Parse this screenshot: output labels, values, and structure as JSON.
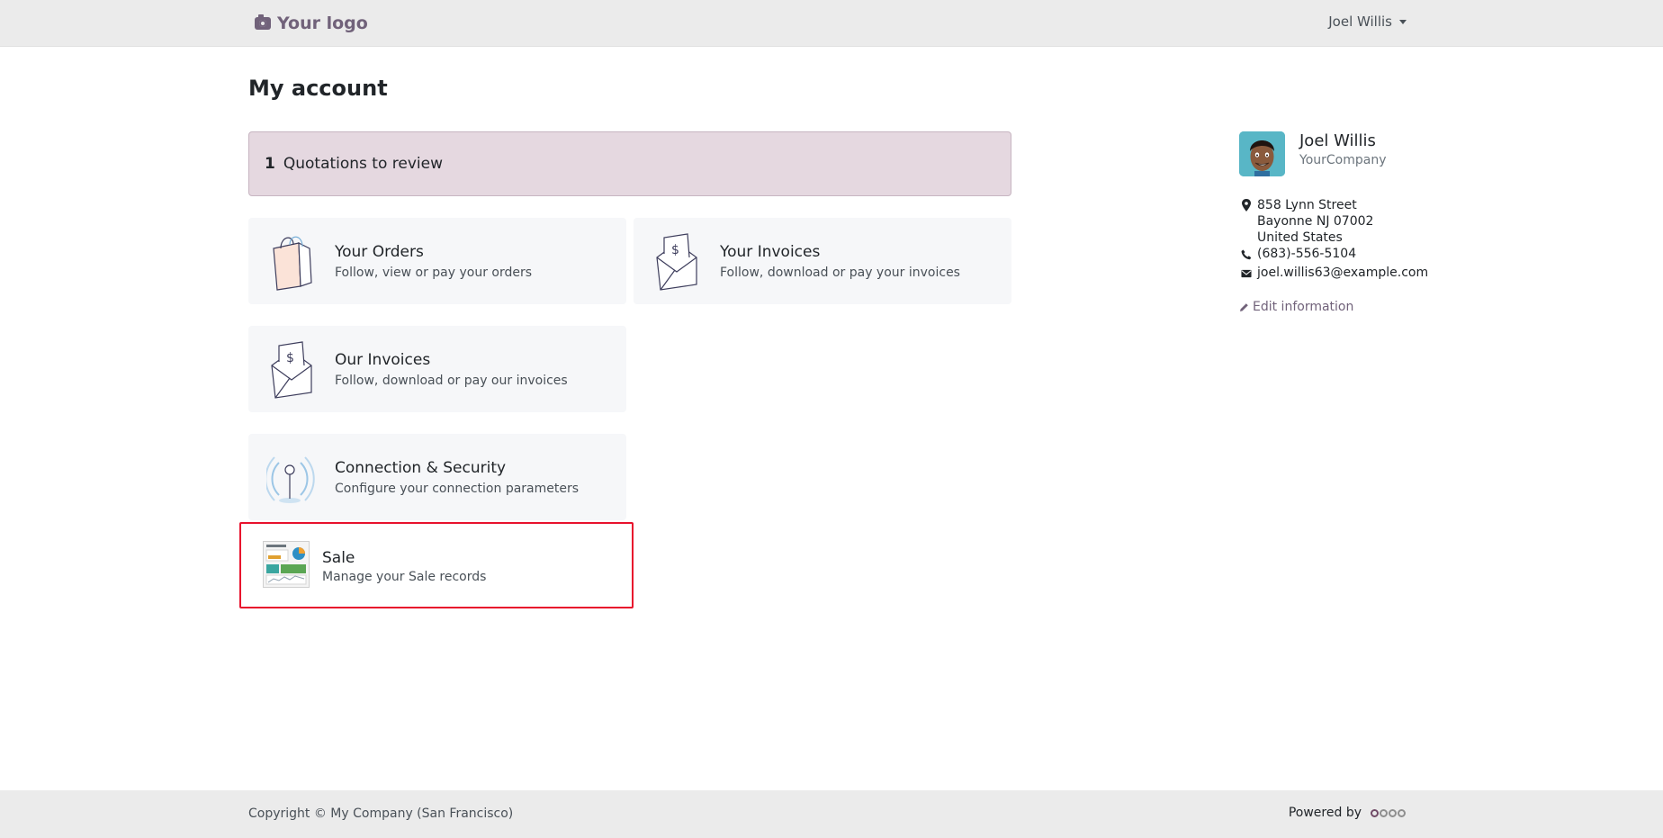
{
  "header": {
    "logo_text": "Your logo",
    "user_name": "Joel Willis"
  },
  "main": {
    "title": "My account",
    "alert": {
      "count": "1",
      "label": "Quotations to review"
    },
    "cards": [
      {
        "title": "Your Orders",
        "description": "Follow, view or pay your orders"
      },
      {
        "title": "Your Invoices",
        "description": "Follow, download or pay your invoices"
      },
      {
        "title": "Our Invoices",
        "description": "Follow, download or pay our invoices"
      },
      {
        "title": "Connection & Security",
        "description": "Configure your connection parameters"
      },
      {
        "title": "Sale",
        "description": "Manage your Sale records"
      }
    ]
  },
  "profile": {
    "name": "Joel Willis",
    "company": "YourCompany",
    "address_line1": "858 Lynn Street",
    "address_line2": "Bayonne NJ 07002",
    "address_line3": "United States",
    "phone": "(683)-556-5104",
    "email": "joel.willis63@example.com",
    "edit_label": "Edit information"
  },
  "footer": {
    "copyright": "Copyright © My Company (San Francisco)",
    "powered_by": "Powered by"
  },
  "colors": {
    "brand": "#71627a",
    "alert_bg": "#e5d8e0",
    "highlight": "#e8112d"
  },
  "icons": {
    "logo": "camera-icon",
    "orders": "shopping-bag-icon",
    "invoices": "dollar-envelope-icon",
    "security": "antenna-icon",
    "sale": "sale-dashboard-icon",
    "address": "map-marker-icon",
    "phone": "phone-icon",
    "email": "envelope-icon",
    "edit": "pencil-icon",
    "footer_brand": "odoo-logo"
  }
}
